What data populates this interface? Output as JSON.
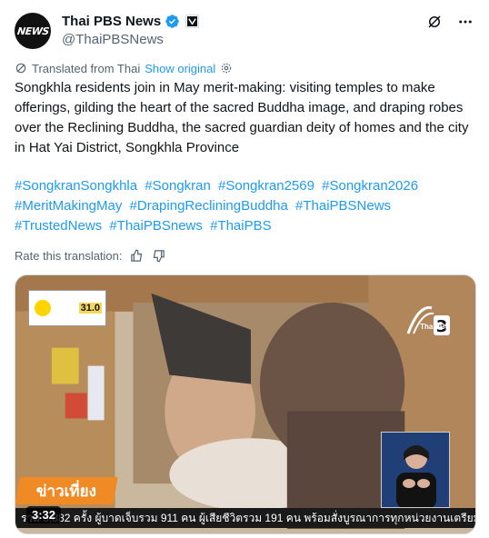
{
  "header": {
    "display_name": "Thai PBS News",
    "handle": "@ThaiPBSNews",
    "avatar_text": "NEWS"
  },
  "translation": {
    "label": "Translated from Thai",
    "show_original": "Show original"
  },
  "post": {
    "text": "Songkhla residents join in May merit-making: visiting temples to make offerings, gilding the heart of the sacred Buddha image, and draping robes over the Reclining Buddha, the sacred guardian deity of homes and the city in Hat Yai District, Songkhla Province",
    "hashtags": [
      "#SongkranSongkhla",
      "#Songkran",
      "#Songkran2569",
      "#Songkran2026",
      "#MeritMakingMay",
      "#DrapingRecliningBuddha",
      "#ThaiPBSNews",
      "#TrustedNews",
      "#ThaiPBSnews",
      "#ThaiPBS"
    ]
  },
  "rate": {
    "label": "Rate this translation:"
  },
  "media": {
    "duration": "3:32",
    "ticker": "รวม 3,882 ครั้ง ผู้บาดเจ็บรวม 911 คน ผู้เสียชีวิตรวม 191 คน พร้อมสั่งบูรณาการทุกหน่วยงานเตรียมรับมือประ",
    "show_logo_text": "ข่าวเที่ยง",
    "weather_temp": "31.0",
    "channel_label": "ThaiPBS"
  },
  "colors": {
    "link": "#1d9bf0",
    "verified": "#1d9bf0",
    "text_primary": "#0f1419",
    "text_secondary": "#536471"
  }
}
